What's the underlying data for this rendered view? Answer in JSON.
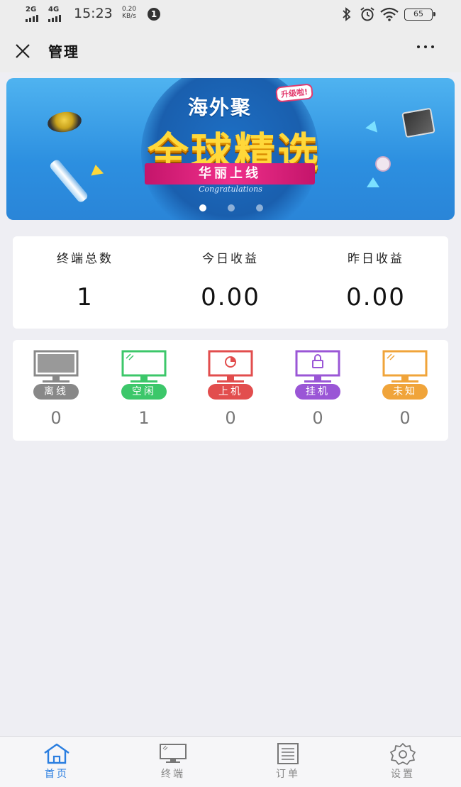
{
  "status_bar": {
    "net1": "2G",
    "net2": "4G",
    "time": "15:23",
    "speed_value": "0.20",
    "speed_unit": "KB/s",
    "notification_count": "1",
    "battery": "65"
  },
  "nav": {
    "title": "管理"
  },
  "banner": {
    "badge": "升级啦!",
    "subtitle": "海外聚",
    "headline": "全球精选",
    "ribbon": "华丽上线",
    "tagline": "Congratulations",
    "slide_count": 3,
    "active_slide": 1
  },
  "stats": [
    {
      "label": "终端总数",
      "value": "1"
    },
    {
      "label": "今日收益",
      "value": "0.00"
    },
    {
      "label": "昨日收益",
      "value": "0.00"
    }
  ],
  "terminal_status": [
    {
      "label": "离线",
      "count": "0",
      "color": "#888888",
      "icon": "monitor-offline-icon"
    },
    {
      "label": "空闲",
      "count": "1",
      "color": "#3cc76a",
      "icon": "monitor-idle-icon"
    },
    {
      "label": "上机",
      "count": "0",
      "color": "#e24d4d",
      "icon": "monitor-online-icon"
    },
    {
      "label": "挂机",
      "count": "0",
      "color": "#9a56d6",
      "icon": "monitor-locked-icon"
    },
    {
      "label": "未知",
      "count": "0",
      "color": "#f0a43a",
      "icon": "monitor-unknown-icon"
    }
  ],
  "tabs": [
    {
      "label": "首页",
      "icon": "home-icon",
      "active": true
    },
    {
      "label": "终端",
      "icon": "monitor-icon",
      "active": false
    },
    {
      "label": "订单",
      "icon": "document-icon",
      "active": false
    },
    {
      "label": "设置",
      "icon": "gear-icon",
      "active": false
    }
  ],
  "colors": {
    "accent": "#2a7ee0",
    "background": "#eeeef3"
  }
}
